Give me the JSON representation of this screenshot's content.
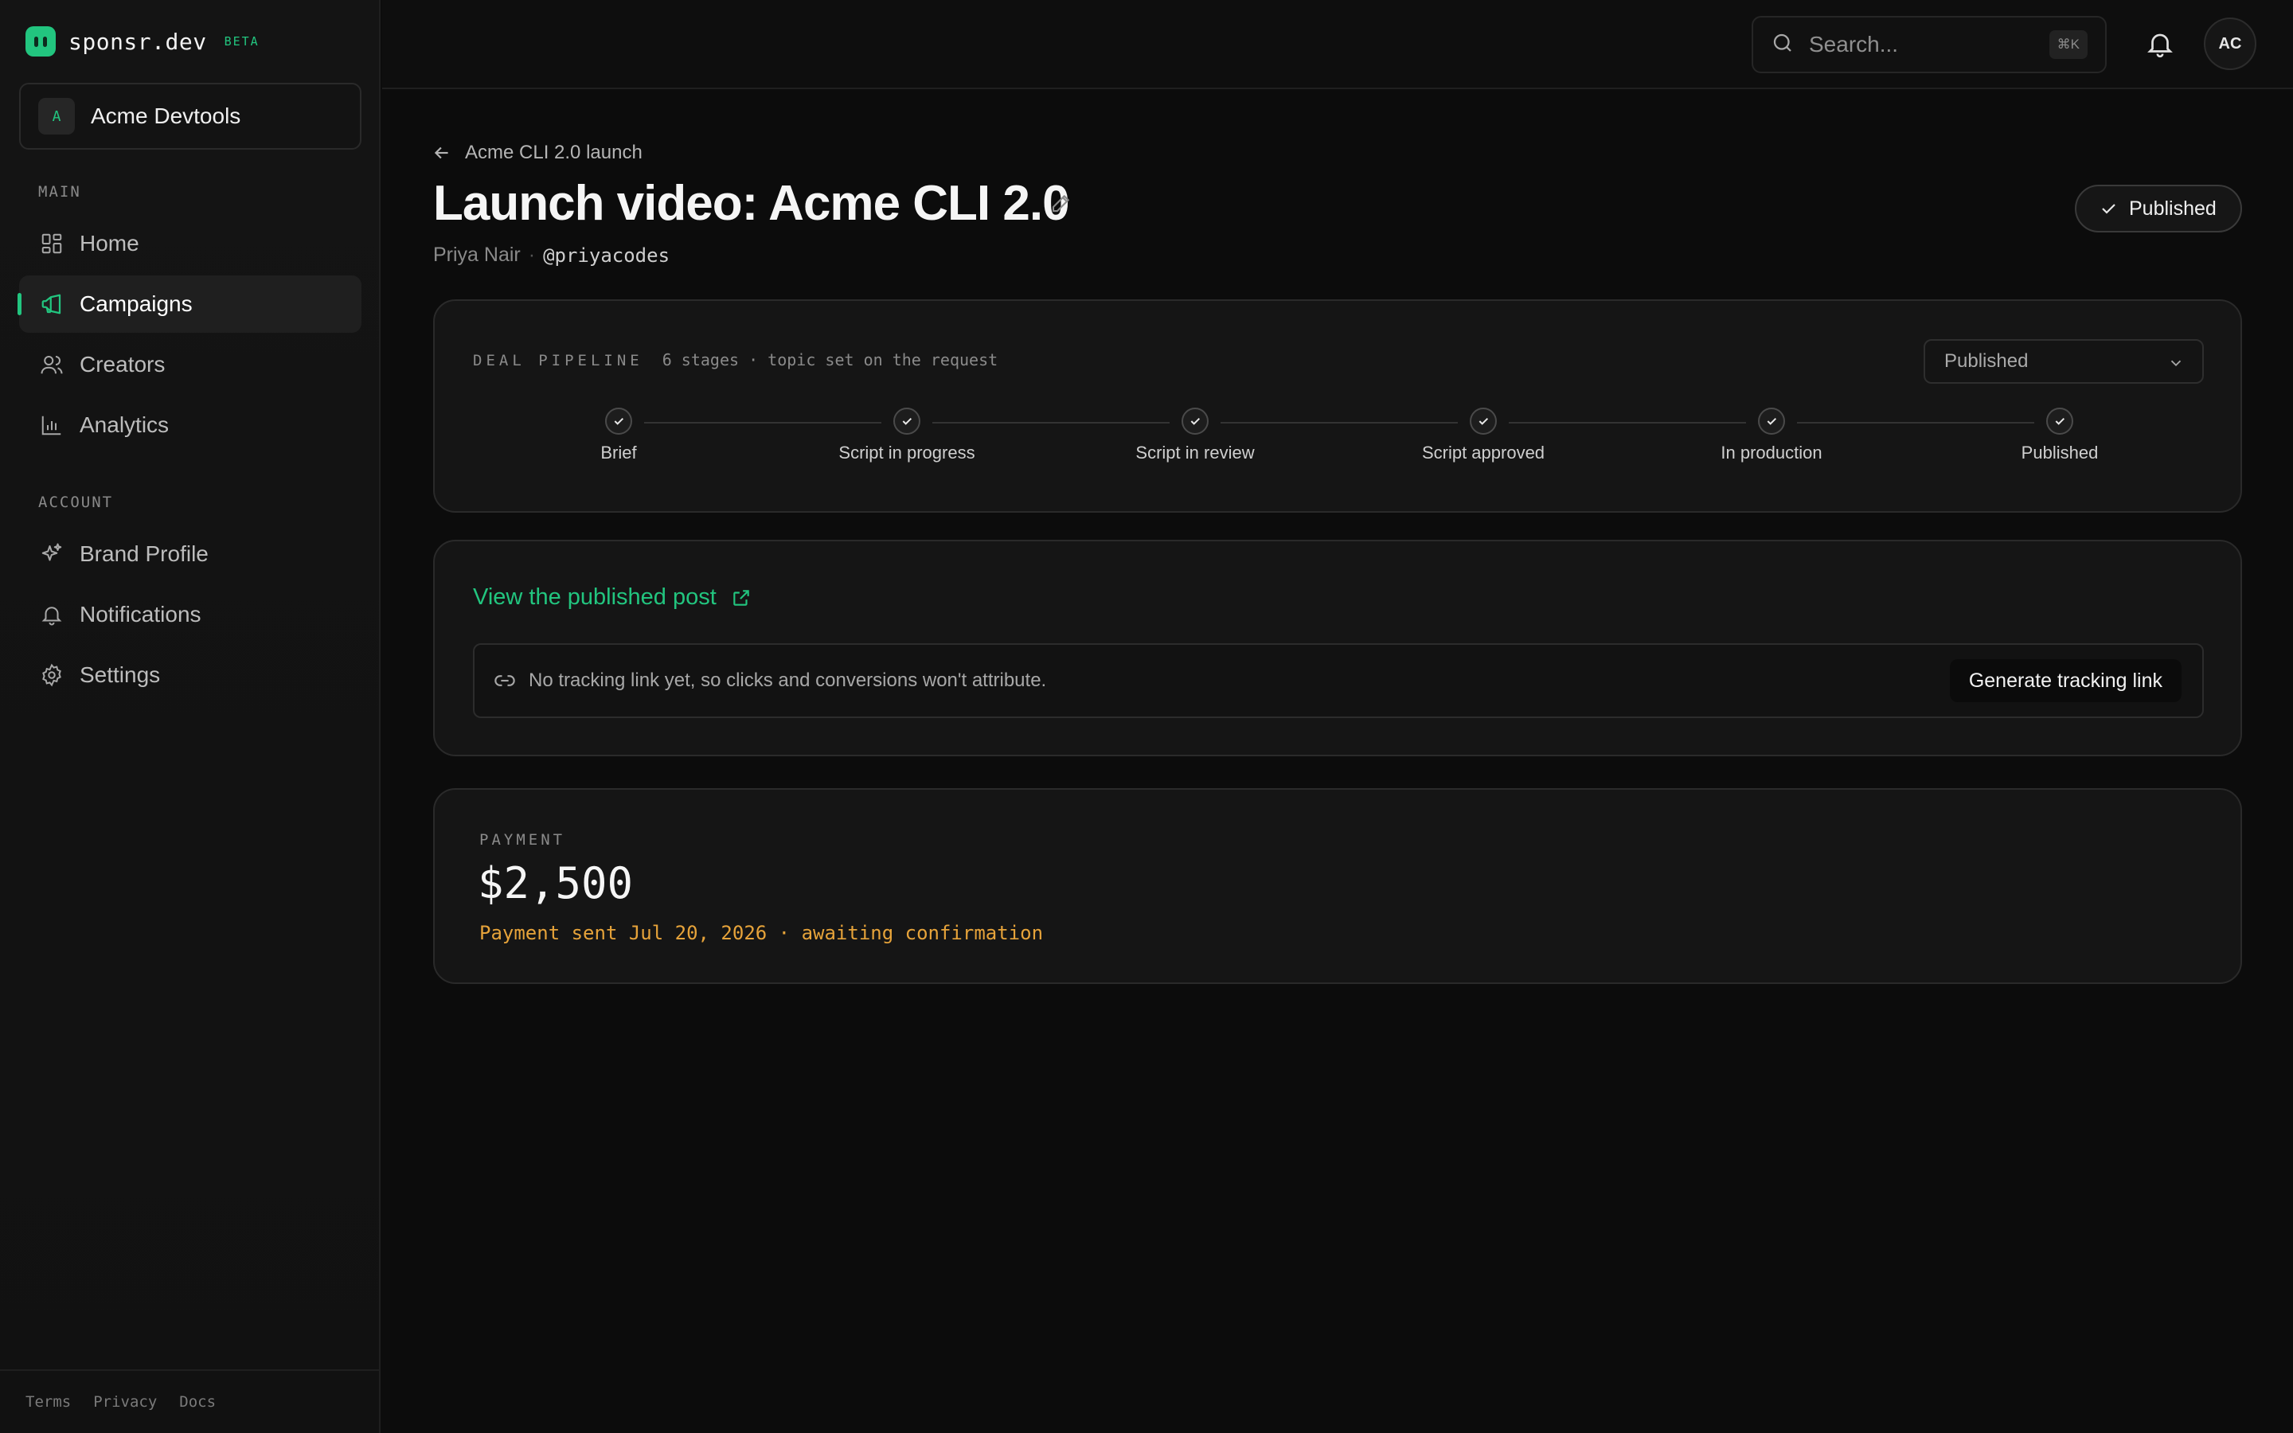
{
  "brand": {
    "name": "sponsr.dev",
    "badge": "BETA",
    "accent": "#22c57f"
  },
  "workspace": {
    "initial": "A",
    "name": "Acme Devtools"
  },
  "sidebar": {
    "main_heading": "MAIN",
    "main_items": [
      {
        "label": "Home",
        "icon": "dashboard-icon"
      },
      {
        "label": "Campaigns",
        "icon": "megaphone-icon",
        "active": true
      },
      {
        "label": "Creators",
        "icon": "users-icon"
      },
      {
        "label": "Analytics",
        "icon": "bar-chart-icon"
      }
    ],
    "account_heading": "ACCOUNT",
    "account_items": [
      {
        "label": "Brand Profile",
        "icon": "sparkles-icon"
      },
      {
        "label": "Notifications",
        "icon": "bell-icon"
      },
      {
        "label": "Settings",
        "icon": "gear-icon"
      }
    ],
    "footer_links": [
      "Terms",
      "Privacy",
      "Docs"
    ]
  },
  "topbar": {
    "search_placeholder": "Search...",
    "search_shortcut": "⌘K",
    "avatar_initials": "AC"
  },
  "page": {
    "back_label": "Acme CLI 2.0 launch",
    "title": "Launch video: Acme CLI 2.0",
    "creator_name": "Priya Nair",
    "creator_separator": "·",
    "creator_handle": "@priyacodes",
    "status": "Published"
  },
  "pipeline": {
    "label": "DEAL PIPELINE",
    "meta": "6 stages · topic set on the request",
    "selected_stage": "Published",
    "stages": [
      "Brief",
      "Script in progress",
      "Script in review",
      "Script approved",
      "In production",
      "Published"
    ]
  },
  "post": {
    "link_label": "View the published post",
    "tracking_message": "No tracking link yet, so clicks and conversions won't attribute.",
    "generate_button": "Generate tracking link"
  },
  "payment": {
    "label": "PAYMENT",
    "amount": "$2,500",
    "status": "Payment sent Jul 20, 2026 · awaiting confirmation",
    "status_color": "#e6a33a"
  }
}
